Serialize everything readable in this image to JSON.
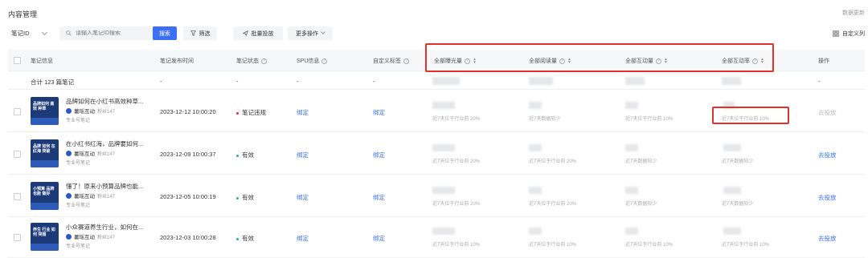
{
  "header": {
    "title": "内容管理",
    "right_link": "数据更新"
  },
  "toolbar": {
    "id_select": "笔记ID",
    "search_placeholder": "请输入笔记ID搜索",
    "search_btn": "搜索",
    "filter_btn": "筛选",
    "batch_btn": "批量投放",
    "more_btn": "更多操作",
    "custom_col": "自定义列"
  },
  "columns": {
    "info": "笔记信息",
    "time": "笔记发布时间",
    "status": "笔记状态",
    "spu": "SPU信息",
    "custom_tag": "自定义标签",
    "impressions": "全部曝光量",
    "reads": "全部阅读量",
    "interactions": "全部互动量",
    "interaction_rate": "全部互动率",
    "action": "操作"
  },
  "total": {
    "label": "合计 123 篇笔记",
    "time": "-",
    "status": "-",
    "spu": "-",
    "tag": "-",
    "action": "-"
  },
  "rows": [
    {
      "title": "品牌如何在小红书高效种草...",
      "thumb_text": "品牌如何 高效 种草",
      "author": "薯瑶互动",
      "fans": "粉丝147",
      "tag": "专业号笔记",
      "time": "2023-12-12 10:00:20",
      "status": "笔记违规",
      "status_color": "#e0312a",
      "spu": "绑定",
      "custom": "绑定",
      "sub_imp": "近7天位于行业前 20%",
      "sub_read": "近7天数据较少",
      "sub_int": "近7天位于行业前 10%",
      "sub_rate": "近7天位于行业前 10%",
      "action": "去投放",
      "action_active": false
    },
    {
      "title": "在小红书红海，品牌要如何...",
      "thumb_text": "品牌 如何 在红海 突破",
      "author": "薯瑶互动",
      "fans": "粉丝147",
      "tag": "专业号笔记",
      "time": "2023-12-09 10:00:37",
      "status": "有效",
      "status_color": "#2bb673",
      "spu": "绑定",
      "custom": "绑定",
      "sub_imp": "近7天位于行业前 20%",
      "sub_read": "近7天位于行业前 20%",
      "sub_int": "近7天数据较少",
      "sub_rate": "近7天数据较少",
      "action": "去投放",
      "action_active": true
    },
    {
      "title": "懂了！原来小预算品牌也能...",
      "thumb_text": "小预算 品牌 也能 做好",
      "author": "薯瑶互动",
      "fans": "粉丝147",
      "tag": "专业号笔记",
      "time": "2023-12-05 10:00:19",
      "status": "有效",
      "status_color": "#2bb673",
      "spu": "绑定",
      "custom": "绑定",
      "sub_imp": "近7天位于行业前 20%",
      "sub_read": "近7天位于行业前 20%",
      "sub_int": "近7天数据较少",
      "sub_rate": "近7天数据较少",
      "action": "去投放",
      "action_active": true
    },
    {
      "title": "小众赛道养生行业，如何在...",
      "thumb_text": "养生 行业 如何 突围",
      "author": "薯瑶互动",
      "fans": "粉丝147",
      "tag": "专业号笔记",
      "time": "2023-12-03 10:00:28",
      "status": "有效",
      "status_color": "#2bb673",
      "spu": "绑定",
      "custom": "绑定",
      "sub_imp": "近7天位于行业前 10%",
      "sub_read": "近7天位于行业前 10%",
      "sub_int": "近7天位于行业前 10%",
      "sub_rate": "近7天位于行业前 10%",
      "action": "去投放",
      "action_active": true
    }
  ]
}
